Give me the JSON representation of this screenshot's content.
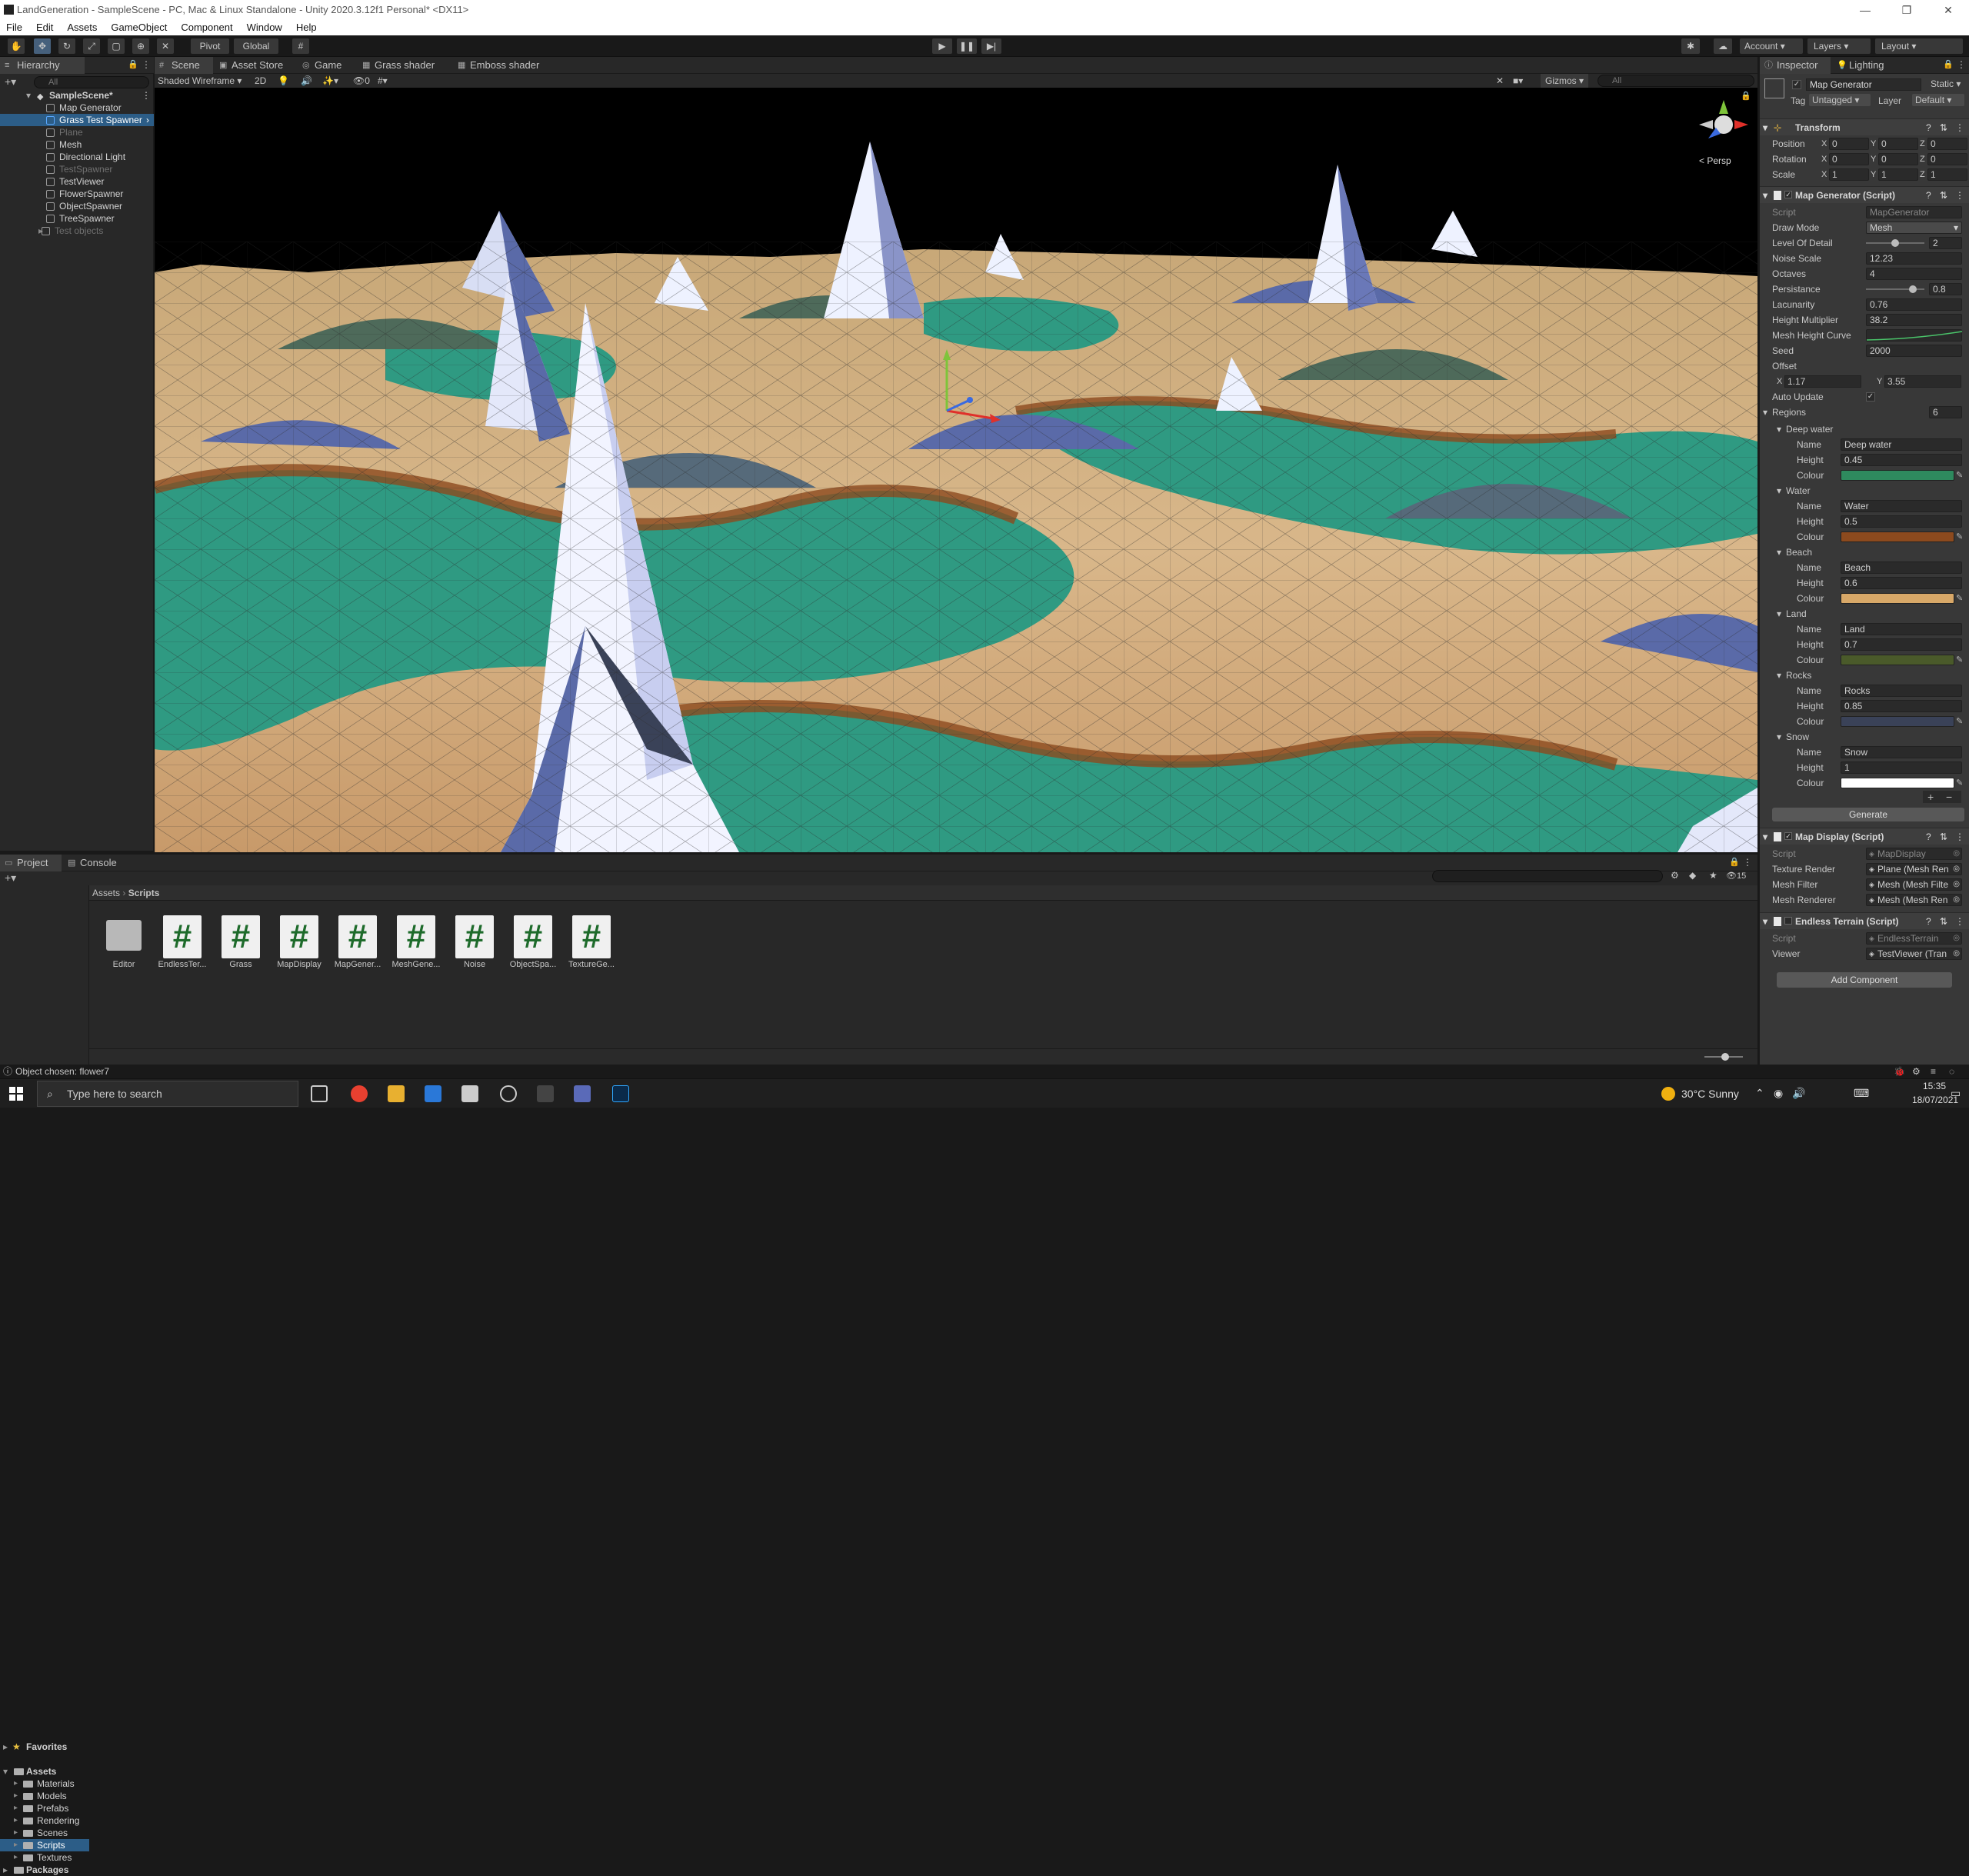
{
  "window": {
    "title": "LandGeneration - SampleScene - PC, Mac & Linux Standalone - Unity 2020.3.12f1 Personal* <DX11>"
  },
  "menu": [
    "File",
    "Edit",
    "Assets",
    "GameObject",
    "Component",
    "Window",
    "Help"
  ],
  "toolbar": {
    "pivot": "Pivot",
    "global": "Global",
    "account": "Account",
    "layers": "Layers",
    "layout": "Layout"
  },
  "hierarchy": {
    "tab": "Hierarchy",
    "search_placeholder": "All",
    "scene": "SampleScene*",
    "items": [
      {
        "label": "Map Generator",
        "state": "normal"
      },
      {
        "label": "Grass Test Spawner",
        "state": "selected"
      },
      {
        "label": "Plane",
        "state": "dim"
      },
      {
        "label": "Mesh",
        "state": "normal"
      },
      {
        "label": "Directional Light",
        "state": "normal"
      },
      {
        "label": "TestSpawner",
        "state": "dim"
      },
      {
        "label": "TestViewer",
        "state": "normal"
      },
      {
        "label": "FlowerSpawner",
        "state": "normal"
      },
      {
        "label": "ObjectSpawner",
        "state": "normal"
      },
      {
        "label": "TreeSpawner",
        "state": "normal"
      },
      {
        "label": "Test objects",
        "state": "dim"
      }
    ]
  },
  "scene": {
    "tabs": [
      "Scene",
      "Asset Store",
      "Game",
      "Grass shader",
      "Emboss shader"
    ],
    "shading": "Shaded Wireframe",
    "mode2d": "2D",
    "gizmos": "Gizmos",
    "search_placeholder": "All",
    "persp": "< Persp",
    "fx_count": "0"
  },
  "inspector": {
    "tabs": [
      "Inspector",
      "Lighting"
    ],
    "object_name": "Map Generator",
    "static": "Static",
    "tag_label": "Tag",
    "tag": "Untagged",
    "layer_label": "Layer",
    "layer": "Default",
    "transform": {
      "title": "Transform",
      "position": {
        "label": "Position",
        "x": "0",
        "y": "0",
        "z": "0"
      },
      "rotation": {
        "label": "Rotation",
        "x": "0",
        "y": "0",
        "z": "0"
      },
      "scale": {
        "label": "Scale",
        "x": "1",
        "y": "1",
        "z": "1"
      }
    },
    "map_generator": {
      "title": "Map Generator (Script)",
      "fields": [
        {
          "label": "Script",
          "value": "MapGenerator",
          "dim": true
        },
        {
          "label": "Draw Mode",
          "value": "Mesh"
        },
        {
          "label": "Level Of Detail",
          "value": "2",
          "slider": 0.5
        },
        {
          "label": "Noise Scale",
          "value": "12.23"
        },
        {
          "label": "Octaves",
          "value": "4"
        },
        {
          "label": "Persistance",
          "value": "0.8",
          "slider": 0.8
        },
        {
          "label": "Lacunarity",
          "value": "0.76"
        },
        {
          "label": "Height Multiplier",
          "value": "38.2"
        },
        {
          "label": "Mesh Height Curve",
          "value": ""
        },
        {
          "label": "Seed",
          "value": "2000"
        },
        {
          "label": "Offset",
          "value": ""
        }
      ],
      "offset_x": "1.17",
      "offset_y": "3.55",
      "auto_update": "Auto Update",
      "auto_check": "✓",
      "regions_label": "Regions",
      "regions_count": "6",
      "regions": [
        {
          "title": "Deep water",
          "name": "Deep water",
          "height": "0.45",
          "colour": "#2e8a5e"
        },
        {
          "title": "Water",
          "name": "Water",
          "height": "0.5",
          "colour": "#8c4a1e"
        },
        {
          "title": "Beach",
          "name": "Beach",
          "height": "0.6",
          "colour": "#d8a868"
        },
        {
          "title": "Land",
          "name": "Land",
          "height": "0.7",
          "colour": "#4a5a2a"
        },
        {
          "title": "Rocks",
          "name": "Rocks",
          "height": "0.85",
          "colour": "#3a4258"
        },
        {
          "title": "Snow",
          "name": "Snow",
          "height": "1",
          "colour": "#ffffff"
        }
      ],
      "row_labels": {
        "name": "Name",
        "height": "Height",
        "colour": "Colour"
      },
      "generate": "Generate"
    },
    "map_display": {
      "title": "Map Display (Script)",
      "fields": [
        {
          "label": "Script",
          "value": "MapDisplay",
          "dim": true
        },
        {
          "label": "Texture Render",
          "value": "Plane (Mesh Ren"
        },
        {
          "label": "Mesh Filter",
          "value": "Mesh (Mesh Filte"
        },
        {
          "label": "Mesh Renderer",
          "value": "Mesh (Mesh Ren"
        }
      ]
    },
    "endless": {
      "title": "Endless Terrain (Script)",
      "fields": [
        {
          "label": "Script",
          "value": "EndlessTerrain",
          "dim": true
        },
        {
          "label": "Viewer",
          "value": "TestViewer (Tran"
        }
      ]
    },
    "add_component": "Add Component"
  },
  "project": {
    "tabs": [
      "Project",
      "Console"
    ],
    "favorites": "Favorites",
    "assets": "Assets",
    "folders": [
      "Materials",
      "Models",
      "Prefabs",
      "Rendering",
      "Scenes",
      "Scripts",
      "Textures"
    ],
    "packages": "Packages",
    "breadcrumb": [
      "Assets",
      "Scripts"
    ],
    "count": "15",
    "items": [
      "Editor",
      "EndlessTer...",
      "Grass",
      "MapDisplay",
      "MapGener...",
      "MeshGene...",
      "Noise",
      "ObjectSpa...",
      "TextureGe..."
    ]
  },
  "status": {
    "message": "Object chosen: flower7"
  },
  "taskbar": {
    "search_placeholder": "Type here to search",
    "weather": "30°C  Sunny",
    "time": "15:35",
    "date": "18/07/2021"
  },
  "colors": {
    "accent": "#2c5d87",
    "panel": "#383838",
    "dark": "#282828",
    "deep_water": "#2e8a5e",
    "water": "#8c4a1e",
    "beach": "#d8a868",
    "snow": "#ffffff",
    "rocks": "#5a6aa8"
  }
}
